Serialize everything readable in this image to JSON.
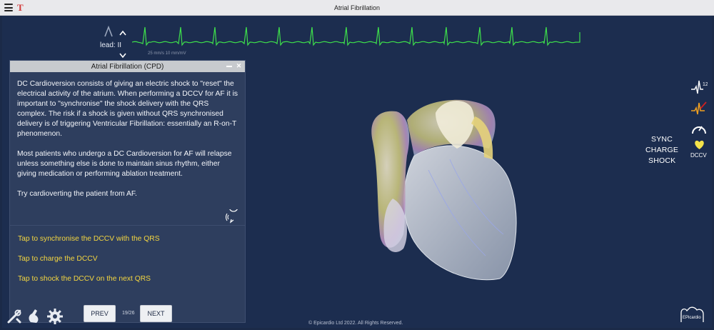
{
  "window": {
    "title": "Atrial Fibrillation"
  },
  "ecg": {
    "lead_label": "lead: II",
    "scale_label": "25 mm/s   10 mm/mV",
    "trace_color": "#3ee04b"
  },
  "panel": {
    "title": "Atrial Fibrillation (CPD)",
    "paragraphs": [
      "DC Cardioversion consists of giving an electric shock to \"reset\" the electrical activity of the atrium.  When performing a DCCV for AF it is important to \"synchronise\" the shock delivery with the QRS complex.  The risk if a shock is given without QRS synchronised delivery is of triggering Ventricular Fibrillation: essentially an R-on-T phenomenon.",
      "Most patients who undergo a DC Cardioversion for AF will relapse unless something else is done to maintain sinus rhythm, either giving medication or performing ablation treatment.",
      "Try cardioverting the patient from AF."
    ],
    "actions": [
      "Tap to synchronise the DCCV with the QRS",
      "Tap to charge the DCCV",
      "Tap to shock the DCCV on the next QRS"
    ],
    "action_color": "#f4d640"
  },
  "navigation": {
    "prev_label": "PREV",
    "next_label": "NEXT",
    "page": "19/26"
  },
  "defib": {
    "sync_label": "SYNC",
    "charge_label": "CHARGE",
    "shock_label": "SHOCK",
    "dccv_label": "DCCV",
    "twelve_lead_label": "12"
  },
  "footer": {
    "copyright": "© Epicardio Ltd 2022. All Rights Reserved.",
    "logo_text": "EPicardio"
  }
}
